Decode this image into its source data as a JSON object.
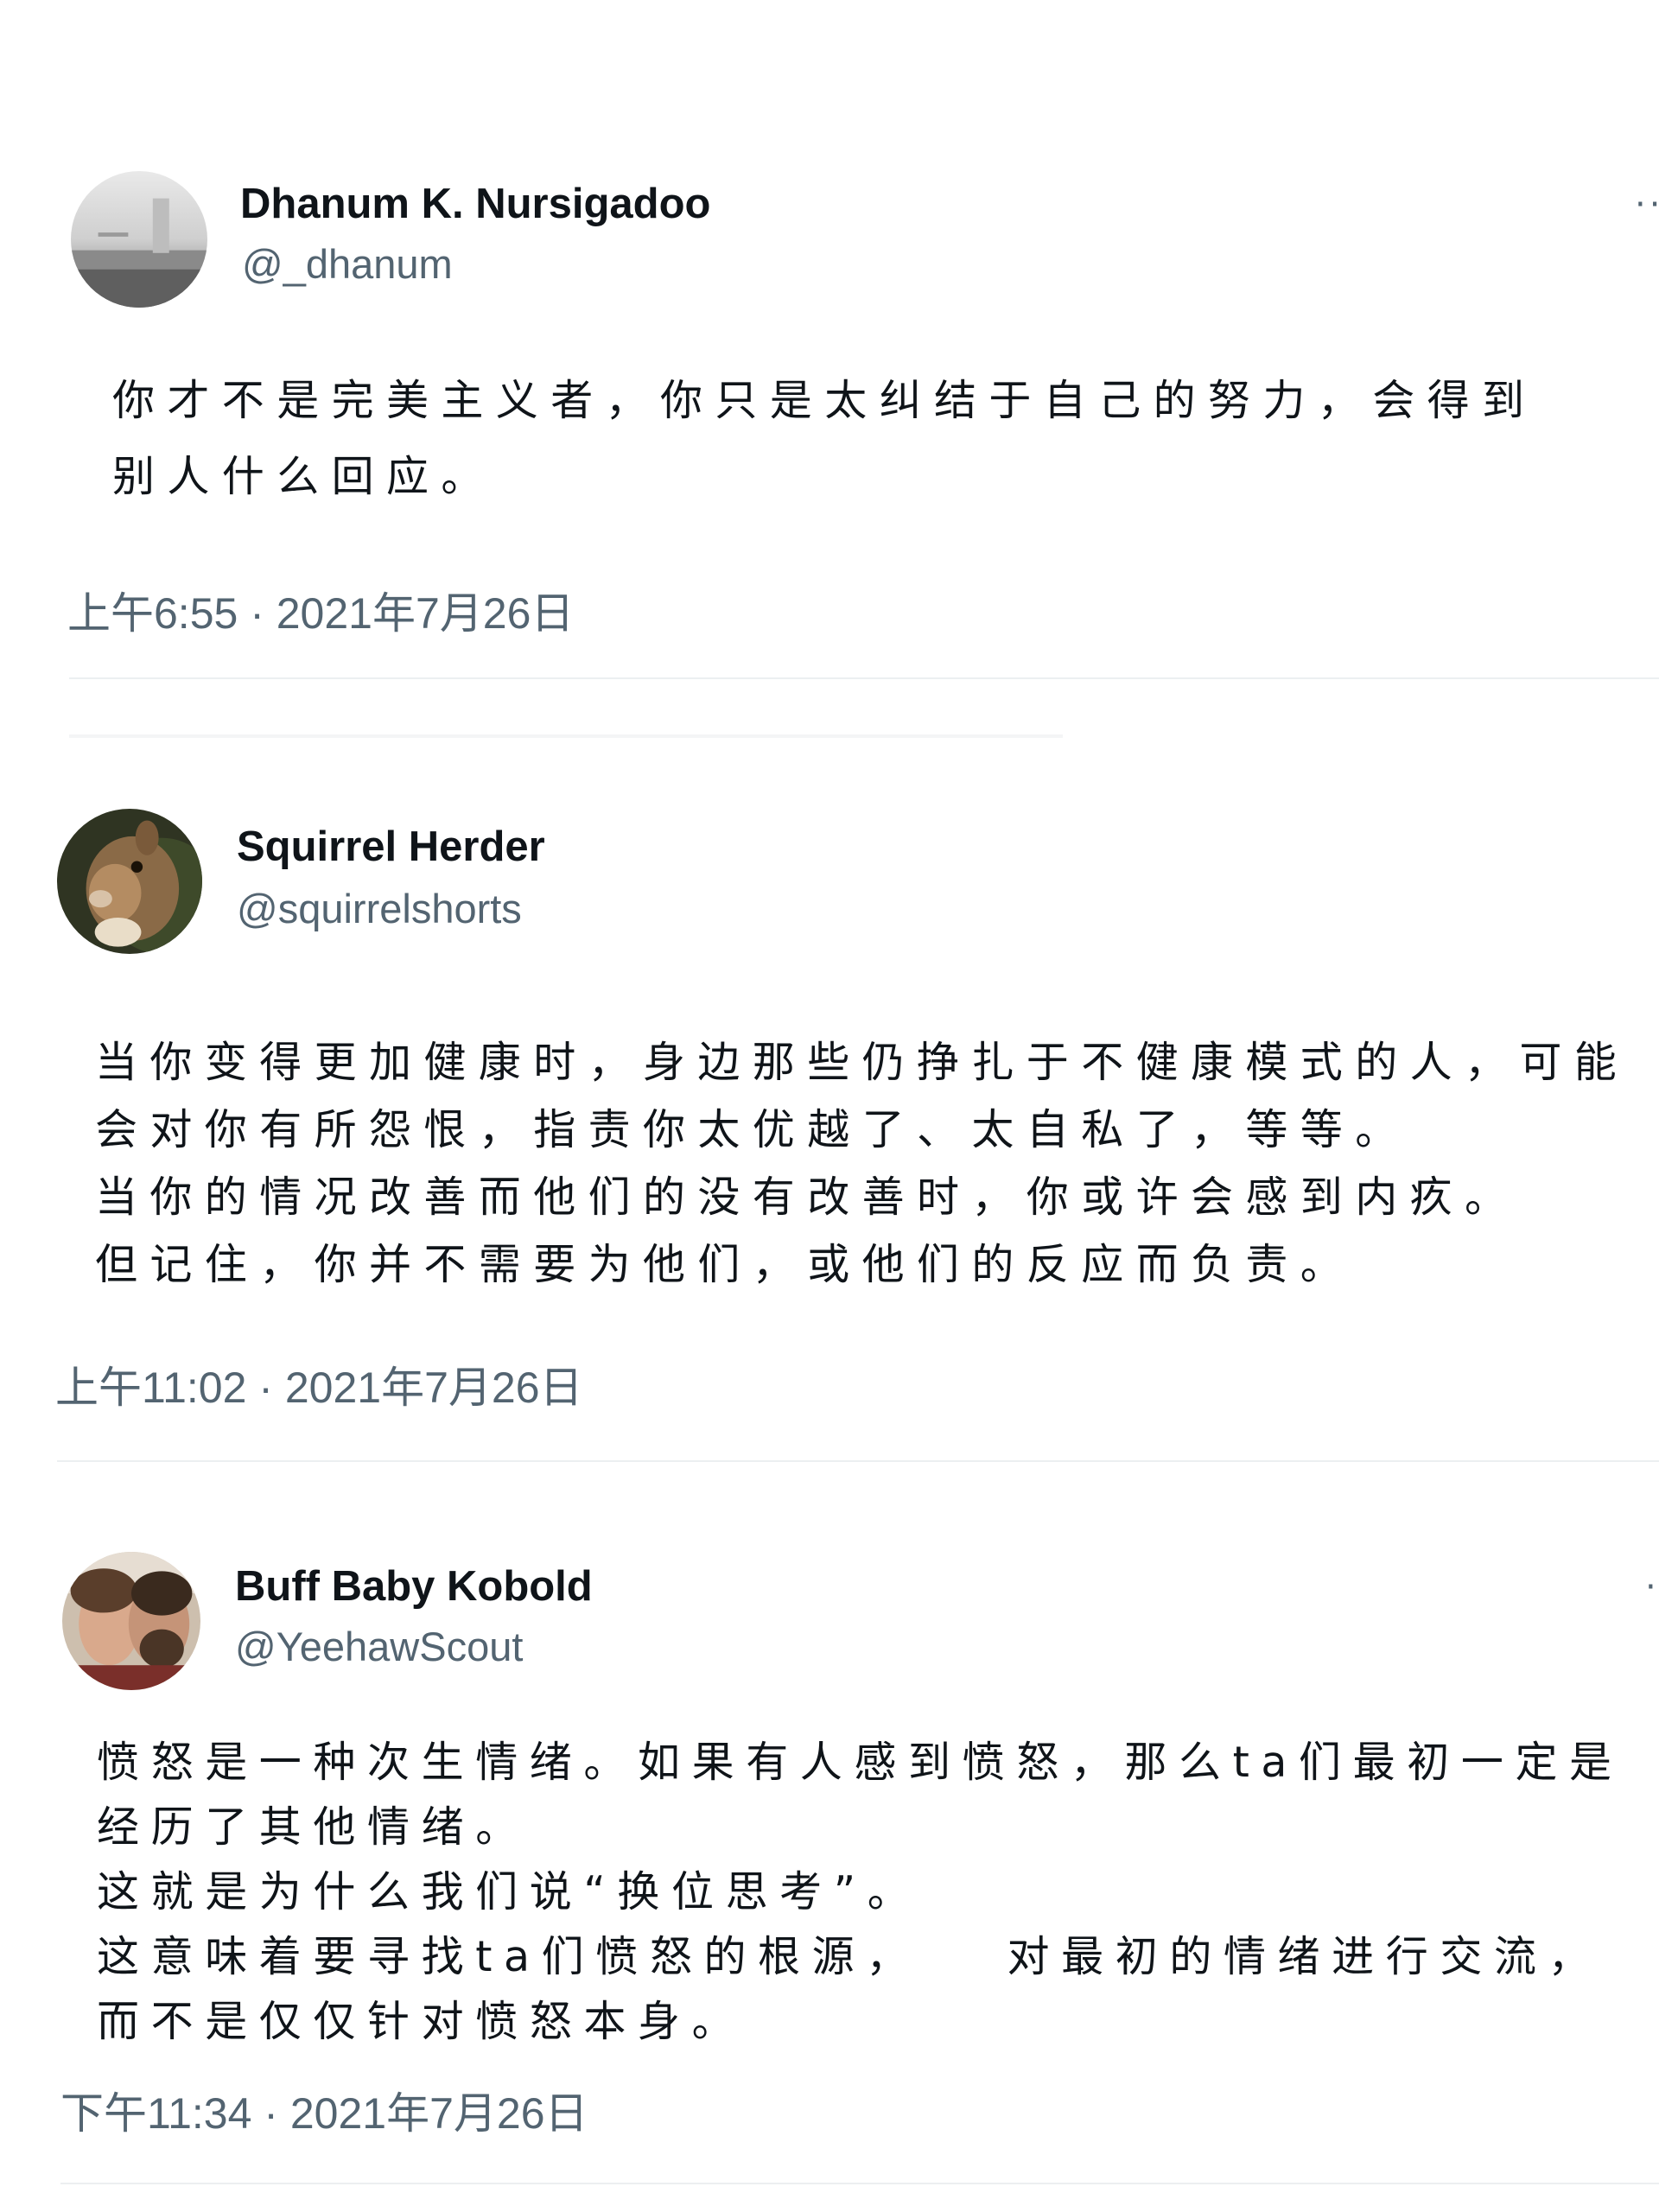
{
  "tweets": [
    {
      "display_name": "Dhanum K. Nursigadoo",
      "handle": "@_dhanum",
      "more_icon": "more-dots-icon",
      "lines": [
        "你才不是完美主义者，你只是太纠结于自己的努力，会得到",
        "别人什么回应。"
      ],
      "timestamp": "上午6:55 · 2021年7月26日"
    },
    {
      "display_name": "Squirrel Herder",
      "handle": "@squirrelshorts",
      "lines": [
        "当你变得更加健康时，身边那些仍挣扎于不健康模式的人，可能",
        "会对你有所怨恨，指责你太优越了、太自私了，等等。",
        "当你的情况改善而他们的没有改善时，你或许会感到内疚。",
        "但记住，你并不需要为他们，或他们的反应而负责。"
      ],
      "timestamp": "上午11:02 · 2021年7月26日"
    },
    {
      "display_name": "Buff Baby Kobold",
      "handle": "@YeehawScout",
      "more_icon": "more-dots-icon",
      "lines": [
        "愤怒是一种次生情绪。如果有人感到愤怒，那么ta们最初一定是",
        "经历了其他情绪。",
        "这就是为什么我们说“换位思考”。",
        "这意味着要寻找ta们愤怒的根源，　　对最初的情绪进行交流，",
        "而不是仅仅针对愤怒本身。"
      ],
      "timestamp": "下午11:34 · 2021年7月26日"
    }
  ],
  "colors": {
    "text_primary": "#0f1419",
    "text_secondary": "#536471",
    "divider": "#eceff1",
    "background": "#ffffff"
  }
}
